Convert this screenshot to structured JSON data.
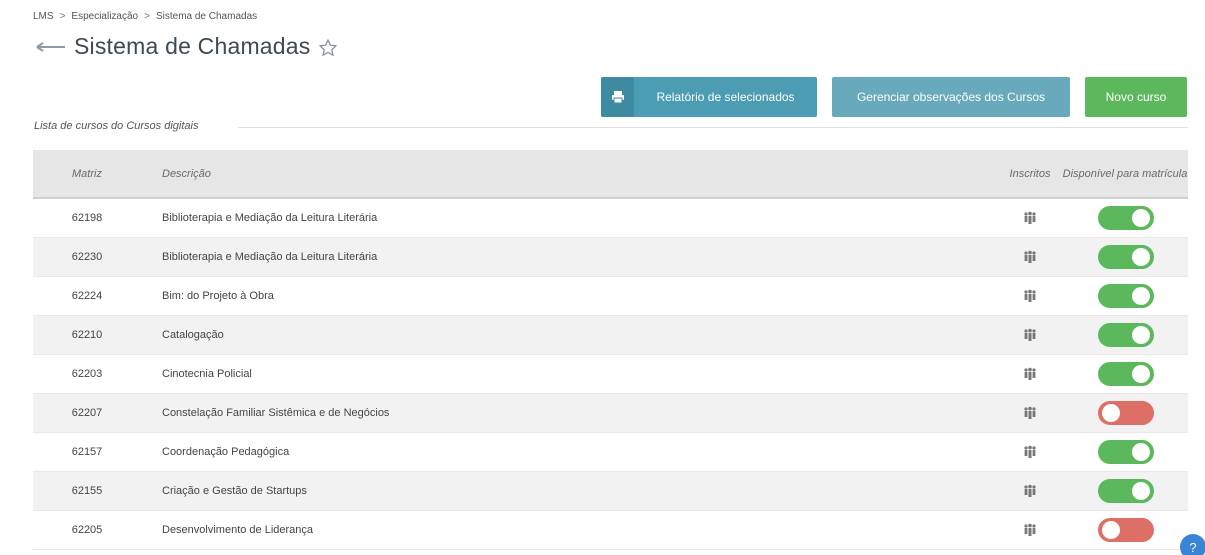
{
  "breadcrumb": [
    "LMS",
    "Especialização",
    "Sistema de Chamadas"
  ],
  "page": {
    "title": "Sistema de Chamadas"
  },
  "buttons": {
    "report": "Relatório de selecionados",
    "manage": "Gerenciar observações dos Cursos",
    "new": "Novo curso"
  },
  "section": {
    "label": "Lista de cursos do Cursos digitais"
  },
  "table": {
    "headers": {
      "matriz": "Matriz",
      "descricao": "Descrição",
      "inscritos": "Inscritos",
      "disponivel": "Disponível para matrícula"
    },
    "rows": [
      {
        "matriz": "62198",
        "descricao": "Biblioterapia e Mediação da Leitura Literária",
        "disponivel": true
      },
      {
        "matriz": "62230",
        "descricao": "Biblioterapia e Mediação da Leitura Literária",
        "disponivel": true
      },
      {
        "matriz": "62224",
        "descricao": "Bim: do Projeto à Obra",
        "disponivel": true
      },
      {
        "matriz": "62210",
        "descricao": "Catalogação",
        "disponivel": true
      },
      {
        "matriz": "62203",
        "descricao": "Cinotecnia Policial",
        "disponivel": true
      },
      {
        "matriz": "62207",
        "descricao": "Constelação Familiar Sistêmica e de Negócios",
        "disponivel": false
      },
      {
        "matriz": "62157",
        "descricao": "Coordenação Pedagógica",
        "disponivel": true
      },
      {
        "matriz": "62155",
        "descricao": "Criação e Gestão de Startups",
        "disponivel": true
      },
      {
        "matriz": "62205",
        "descricao": "Desenvolvimento de Liderança",
        "disponivel": false
      }
    ]
  },
  "colors": {
    "on": "#5cb85c",
    "off": "#de6f66",
    "accent": "#4c9cb3"
  },
  "help": {
    "label": "?"
  }
}
